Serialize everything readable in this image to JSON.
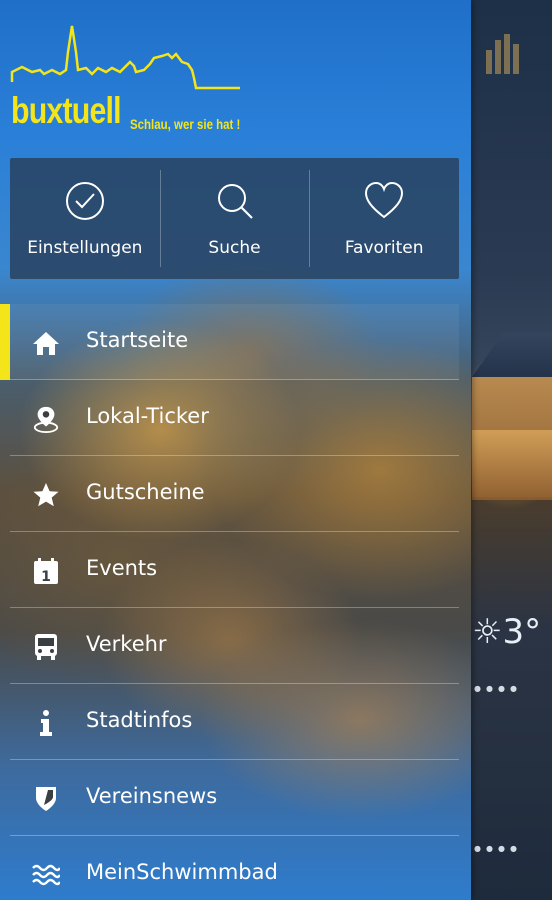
{
  "brand": {
    "name": "buxtuell",
    "slogan": "Schlau, wer sie hat !",
    "colors": {
      "brand_yellow": "#f4e51a",
      "drawer_blue": "#2a80d8"
    }
  },
  "quick_actions": [
    {
      "label": "Einstellungen",
      "icon": "check-circle-icon"
    },
    {
      "label": "Suche",
      "icon": "search-icon"
    },
    {
      "label": "Favoriten",
      "icon": "heart-icon"
    }
  ],
  "menu": [
    {
      "label": "Startseite",
      "icon": "home-icon",
      "active": true
    },
    {
      "label": "Lokal-Ticker",
      "icon": "location-pin-icon",
      "active": false
    },
    {
      "label": "Gutscheine",
      "icon": "star-icon",
      "active": false
    },
    {
      "label": "Events",
      "icon": "calendar-icon",
      "active": false
    },
    {
      "label": "Verkehr",
      "icon": "bus-icon",
      "active": false
    },
    {
      "label": "Stadtinfos",
      "icon": "info-icon",
      "active": false
    },
    {
      "label": "Vereinsnews",
      "icon": "shield-icon",
      "active": false
    },
    {
      "label": "MeinSchwimmbad",
      "icon": "waves-icon",
      "active": false
    }
  ],
  "background": {
    "weather_temp": "3°"
  }
}
